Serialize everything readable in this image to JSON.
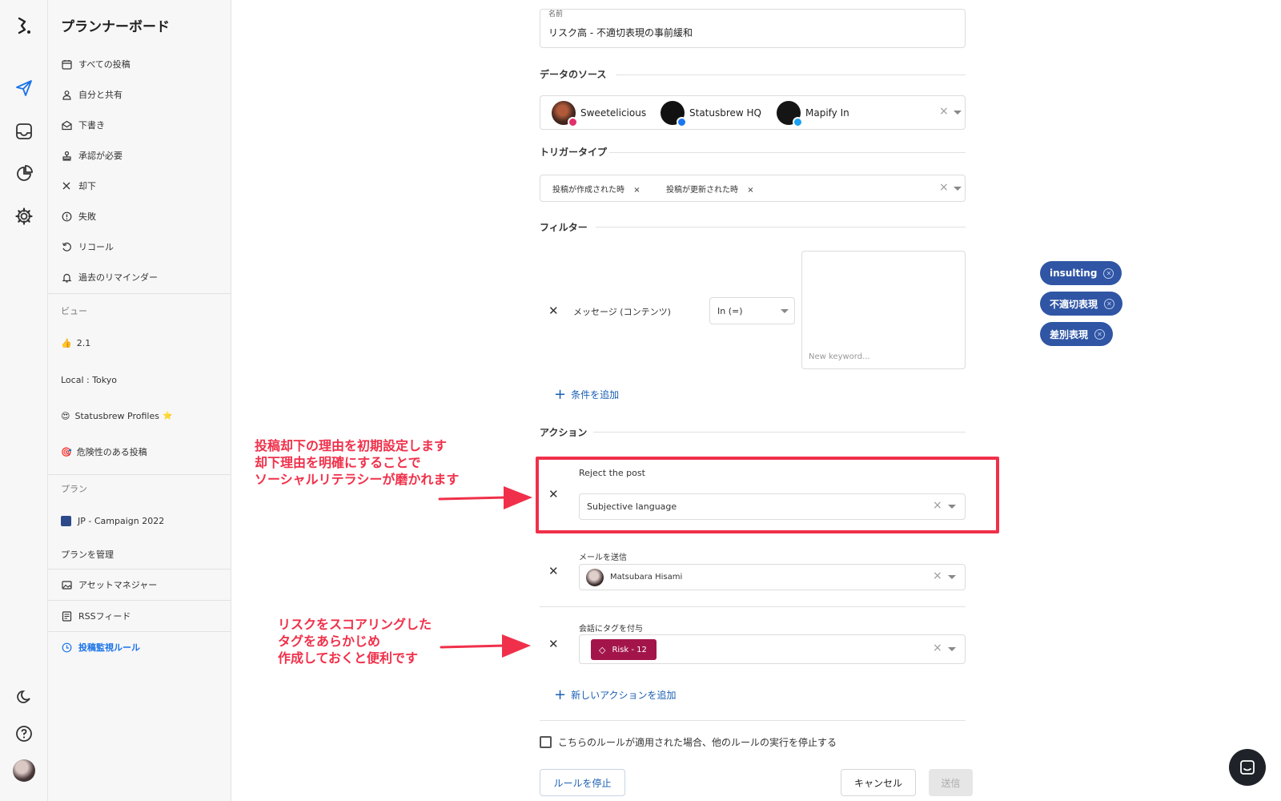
{
  "sidebar": {
    "title": "プランナーボード",
    "items": [
      {
        "label": "すべての投稿",
        "icon": "calendar-icon"
      },
      {
        "label": "自分と共有",
        "icon": "person-icon"
      },
      {
        "label": "下書き",
        "icon": "draft-icon"
      },
      {
        "label": "承認が必要",
        "icon": "stamp-icon"
      },
      {
        "label": "却下",
        "icon": "close-icon"
      },
      {
        "label": "失敗",
        "icon": "alert-icon"
      },
      {
        "label": "リコール",
        "icon": "undo-icon"
      },
      {
        "label": "過去のリマインダー",
        "icon": "bell-icon"
      }
    ],
    "views_heading": "ビュー",
    "views": [
      {
        "emoji": "👍",
        "label": "2.1"
      },
      {
        "emoji": "",
        "label": "Local : Tokyo"
      },
      {
        "emoji": "😍",
        "label": "Statusbrew Profiles",
        "suffix": "⭐"
      },
      {
        "emoji": "🎯",
        "label": "危険性のある投稿"
      }
    ],
    "plans_heading": "プラン",
    "plans": [
      {
        "label": "JP - Campaign 2022",
        "color": "#2c4a8a"
      }
    ],
    "manage_plans": "プランを管理",
    "asset_manager": "アセットマネジャー",
    "rss_feed": "RSSフィード",
    "monitor_rules": "投稿監視ルール"
  },
  "form": {
    "name_label": "名前",
    "name_value": "リスク高 - 不適切表現の事前緩和",
    "data_source_heading": "データのソース",
    "sources": [
      {
        "name": "Sweetelicious",
        "network": "instagram"
      },
      {
        "name": "Statusbrew HQ",
        "network": "facebook"
      },
      {
        "name": "Mapify In",
        "network": "twitter"
      }
    ],
    "trigger_heading": "トリガータイプ",
    "triggers": [
      "投稿が作成された時",
      "投稿が更新された時"
    ],
    "filter_heading": "フィルター",
    "filter_field": "メッセージ (コンテンツ)",
    "filter_operator": "In (=)",
    "keywords": [
      "insulting",
      "不適切表現",
      "差別表現"
    ],
    "keyword_placeholder": "New keyword...",
    "add_condition": "条件を追加",
    "action_heading": "アクション",
    "reject_label": "Reject the post",
    "reject_value": "Subjective language",
    "email_label": "メールを送信",
    "email_value": "Matsubara Hisami",
    "tag_label": "会話にタグを付与",
    "tag_value": "Risk - 12",
    "add_action": "新しいアクションを追加",
    "stop_rules_text": "こちらのルールが適用された場合、他のルールの実行を停止する",
    "stop_rule_button": "ルールを停止",
    "cancel_button": "キャンセル",
    "submit_button": "送信"
  },
  "annotations": {
    "reject_note": [
      "投稿却下の理由を初期設定します",
      "却下理由を明確にすることで",
      "ソーシャルリテラシーが磨かれます"
    ],
    "tag_note": [
      "リスクをスコアリングした",
      "タグをあらかじめ",
      "作成しておくと便利です"
    ]
  },
  "colors": {
    "accent": "#1a73e8",
    "chip": "#2f55a4",
    "tag": "#a3154a",
    "highlight": "#f0304a"
  }
}
